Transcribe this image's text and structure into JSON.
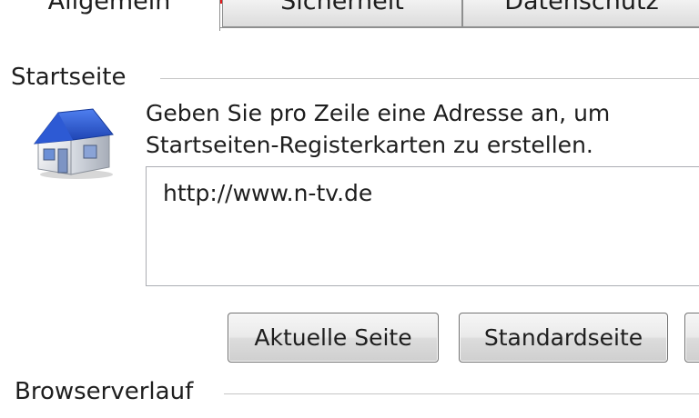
{
  "tabs": [
    {
      "label": "Allgemein",
      "active": true
    },
    {
      "label": "Sicherheit",
      "active": false
    },
    {
      "label": "Datenschutz",
      "active": false
    }
  ],
  "startpage": {
    "header": "Startseite",
    "description_line1": "Geben Sie pro Zeile eine Adresse an, um",
    "description_line2": "Startseiten-Registerkarten zu erstellen.",
    "address_value": "http://www.n-tv.de",
    "icon": "house-icon"
  },
  "buttons": {
    "current_page": "Aktuelle Seite",
    "default_page": "Standardseite"
  },
  "history": {
    "header": "Browserverlauf"
  },
  "colors": {
    "accent_red": "#e3191b",
    "roof_blue": "#1f4fc4"
  }
}
